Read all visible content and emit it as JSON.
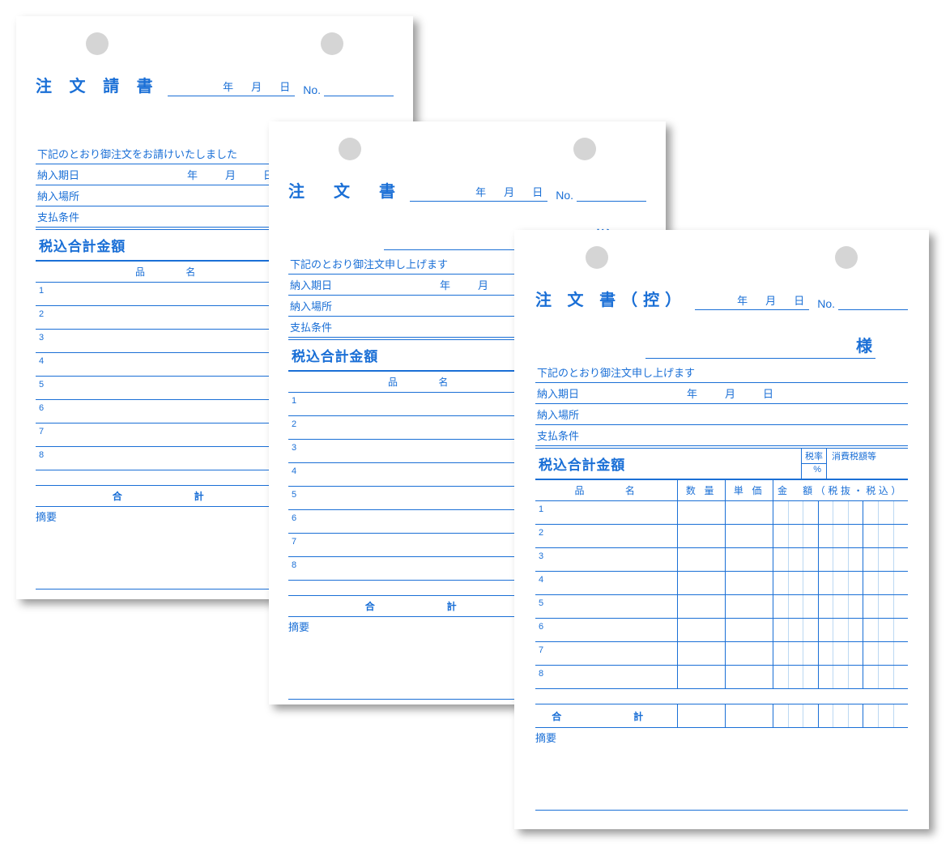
{
  "common": {
    "year_label": "年",
    "month_label": "月",
    "day_label": "日",
    "no_label": "No.",
    "sama": "様",
    "delivery_date_label": "納入期日",
    "delivery_place_label": "納入場所",
    "payment_terms_label": "支払条件",
    "total_incl_tax_label": "税込合計金額",
    "tax_rate_label": "税率",
    "tax_rate_unit": "%",
    "tax_amount_label": "消費税額等",
    "col_name": "品　　　名",
    "col_qty": "数 量",
    "col_price": "単 価",
    "col_amount": "金　額",
    "col_amount_sub": "（税抜・税込）",
    "total_label": "合　　計",
    "notes_label": "摘要",
    "row_numbers": [
      "1",
      "2",
      "3",
      "4",
      "5",
      "6",
      "7",
      "8"
    ]
  },
  "back": {
    "title": "注 文 請 書",
    "memo": "下記のとおり御注文をお請けいたしました"
  },
  "mid": {
    "title": "注　文　書",
    "memo": "下記のとおり御注文申し上げます"
  },
  "front": {
    "title": "注 文 書（控）",
    "memo": "下記のとおり御注文申し上げます"
  }
}
